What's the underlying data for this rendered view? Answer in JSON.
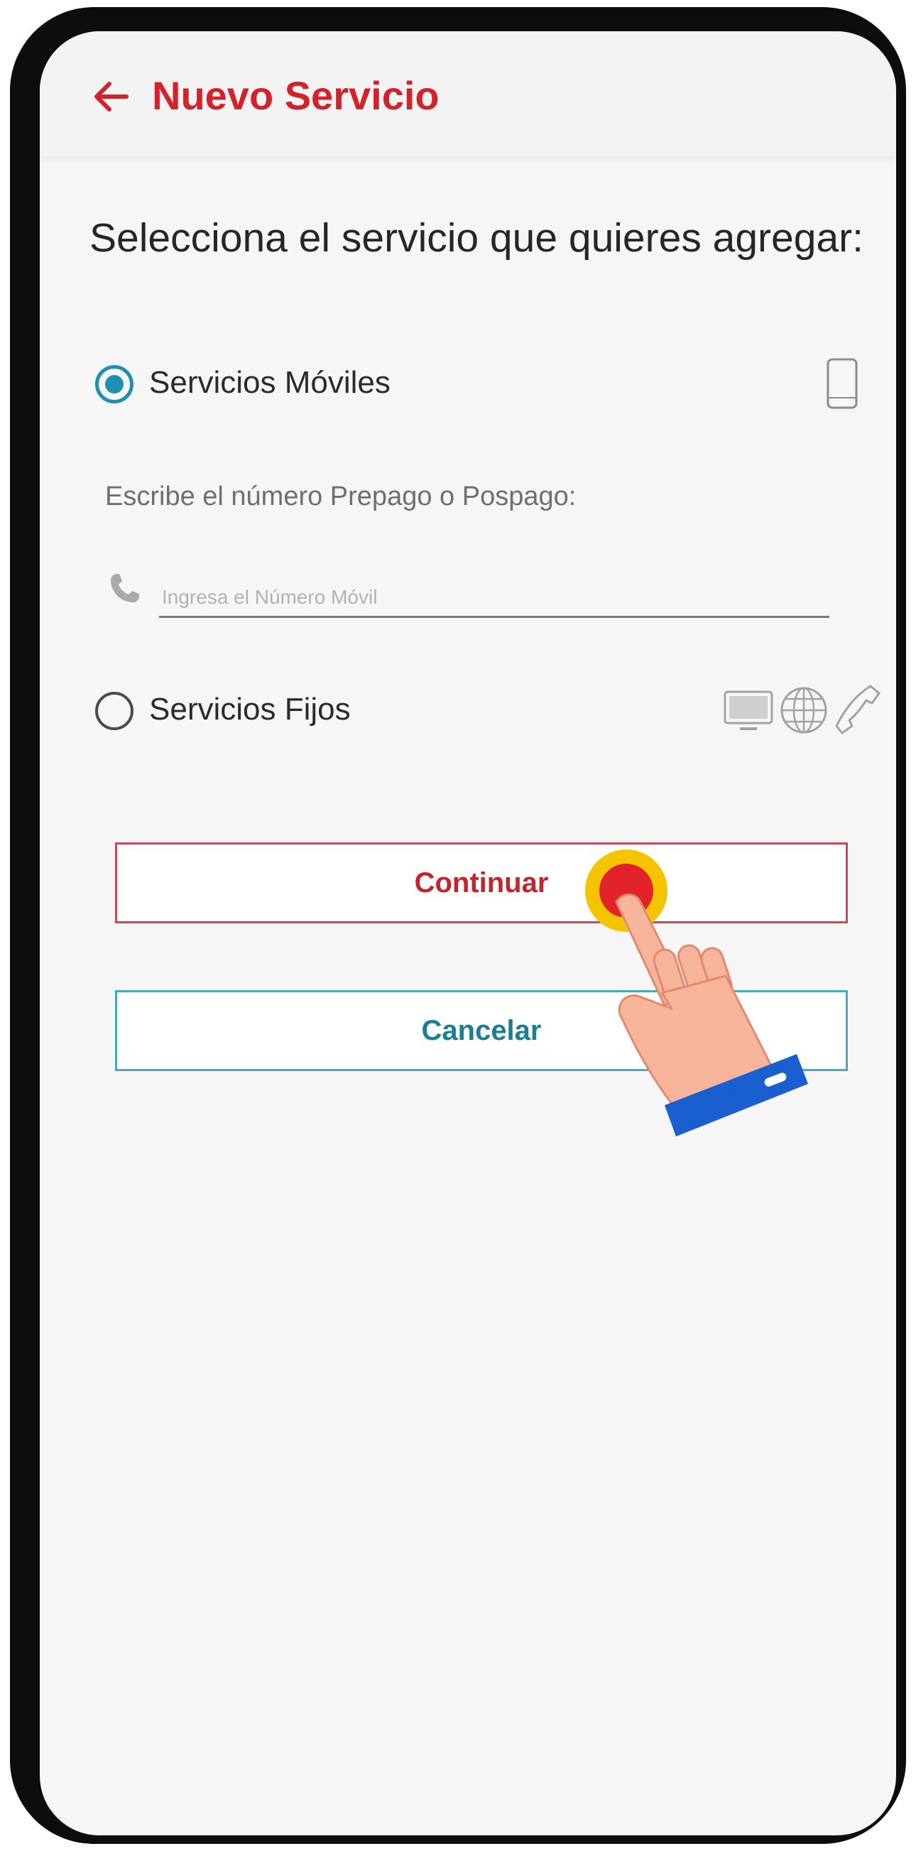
{
  "appbar": {
    "title": "Nuevo Servicio",
    "back_icon": "arrow-left-icon"
  },
  "prompt": "Selecciona el servicio que quieres agregar:",
  "options": {
    "mobile": {
      "label": "Servicios Móviles",
      "selected": true,
      "icon": "smartphone-icon"
    },
    "fixed": {
      "label": "Servicios Fijos",
      "selected": false,
      "icons": [
        "tv-icon",
        "globe-icon",
        "telephone-icon"
      ]
    }
  },
  "mobile_input": {
    "helper": "Escribe el número Prepago o Pospago:",
    "placeholder": "Ingresa el Número Móvil",
    "value": "",
    "icon": "phone-handset-icon"
  },
  "buttons": {
    "continue_label": "Continuar",
    "cancel_label": "Cancelar"
  },
  "overlay": {
    "pointer_icon": "tap-hand-icon"
  },
  "colors": {
    "brand_red": "#d2232a",
    "radio_blue": "#1f8fb3",
    "cancel_teal": "#1a7f92",
    "tap_yellow": "#f5c400"
  }
}
